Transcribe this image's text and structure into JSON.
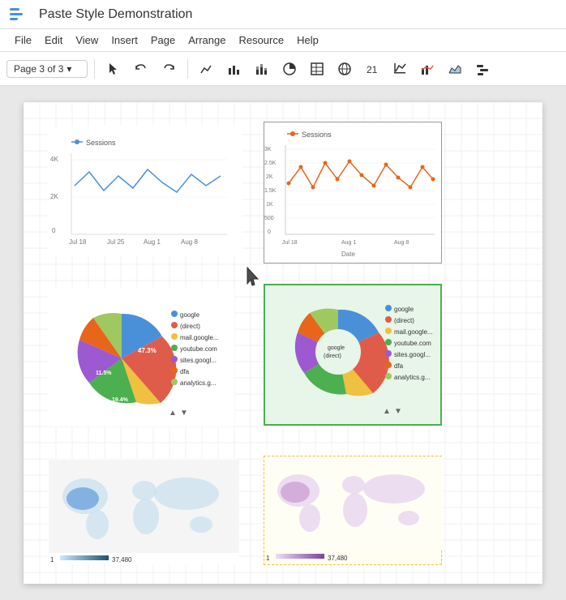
{
  "app": {
    "title": "Paste Style Demonstration",
    "logo_unicode": "≡"
  },
  "menu": {
    "items": [
      "File",
      "Edit",
      "View",
      "Insert",
      "Page",
      "Arrange",
      "Resource",
      "Help"
    ]
  },
  "toolbar": {
    "page_selector": "Page 3 of 3",
    "chevron": "▾"
  },
  "charts": {
    "line1": {
      "title": "Sessions",
      "y_labels": [
        "4K",
        "2K",
        "0"
      ],
      "x_labels": [
        "Jul 18",
        "Jul 25",
        "Aug 1",
        "Aug 8"
      ],
      "color": "#4a90d9"
    },
    "line2": {
      "title": "Sessions",
      "y_labels": [
        "3K",
        "2.5K",
        "2K",
        "1.5K",
        "1K",
        "500",
        "0"
      ],
      "x_labels": [
        "Jul 18",
        "Aug 1",
        "Aug 8"
      ],
      "x_axis_label": "Date",
      "color": "#e8651a"
    },
    "pie1": {
      "legend": [
        "google",
        "(direct)",
        "mail.google...",
        "youtube.com",
        "sites.googl...",
        "dfa",
        "analytics.g..."
      ],
      "colors": [
        "#4a90d9",
        "#e05c4a",
        "#f0c040",
        "#4CAF50",
        "#9c59d1",
        "#e8651a",
        "#a0c860"
      ],
      "labels": [
        "47.3%",
        "19.4%",
        "11.5%"
      ]
    },
    "pie2": {
      "legend": [
        "google",
        "(direct)",
        "mail.google...",
        "youtube.com",
        "sites.googl...",
        "dfa",
        "analytics.g..."
      ],
      "colors": [
        "#4a90d9",
        "#e05c4a",
        "#f0c040",
        "#4CAF50",
        "#9c59d1",
        "#e8651a",
        "#a0c860"
      ],
      "center_labels": [
        "google",
        "(direct)"
      ]
    },
    "map1": {
      "range_min": "1",
      "range_max": "37,480",
      "color": "#4a90d9"
    },
    "map2": {
      "range_min": "1",
      "range_max": "37,480",
      "color": "#c89ad0"
    }
  }
}
